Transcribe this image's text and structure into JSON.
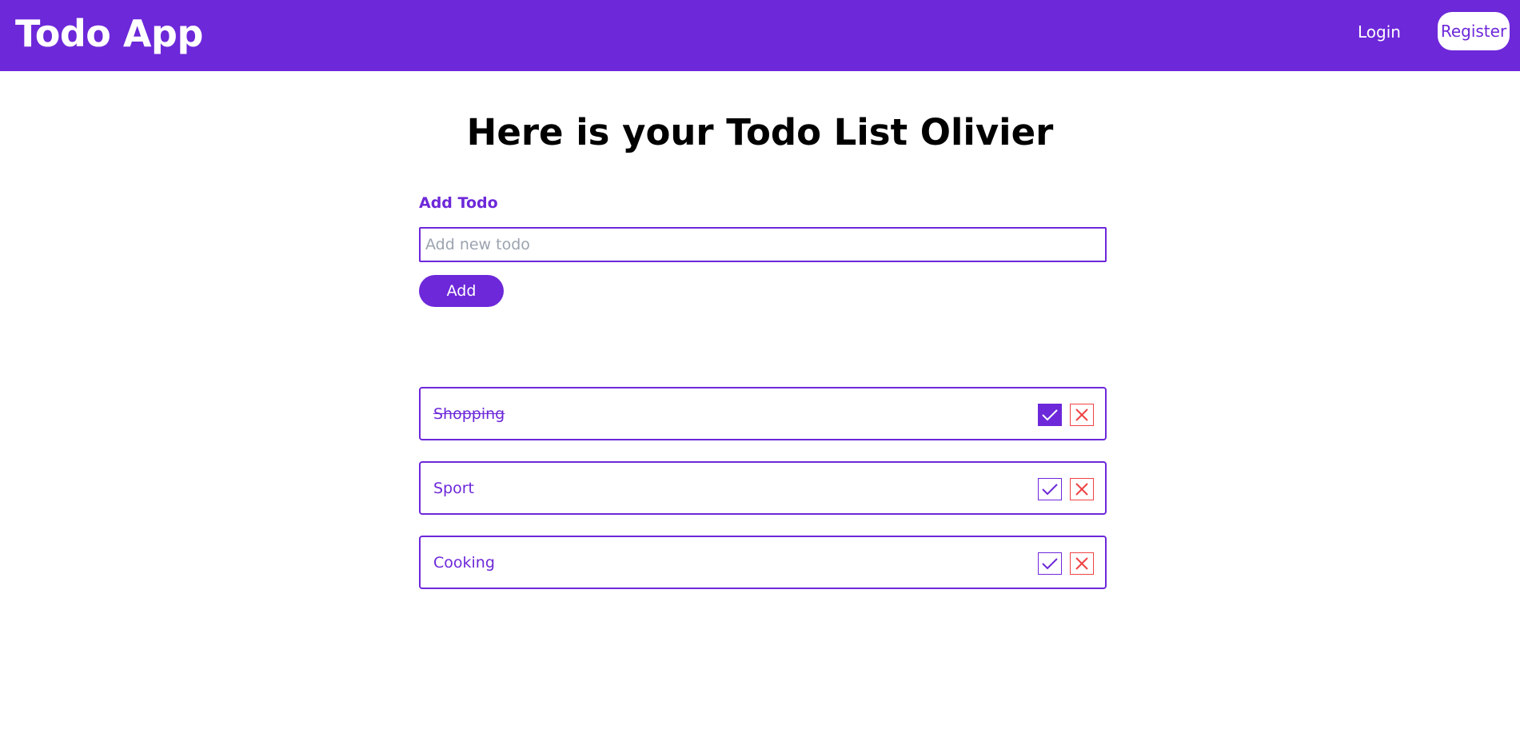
{
  "header": {
    "brand": "Todo App",
    "login_label": "Login",
    "register_label": "Register"
  },
  "main": {
    "title": "Here is your Todo List Olivier",
    "form": {
      "label": "Add Todo",
      "input_value": "",
      "input_placeholder": "Add new todo",
      "add_label": "Add"
    },
    "todos": [
      {
        "text": "Shopping",
        "completed": true
      },
      {
        "text": "Sport",
        "completed": false
      },
      {
        "text": "Cooking",
        "completed": false
      }
    ]
  },
  "colors": {
    "primary": "#6d28d9",
    "danger": "#ef4444",
    "background": "#ffffff"
  },
  "icons": {
    "check": "check-icon",
    "delete": "close-icon"
  }
}
